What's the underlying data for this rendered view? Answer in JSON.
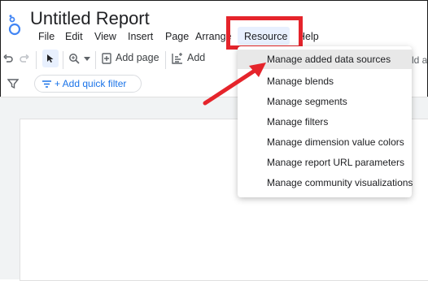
{
  "app": {
    "title": "Untitled Report"
  },
  "menubar": {
    "items": [
      "File",
      "Edit",
      "View",
      "Insert",
      "Page",
      "Arrange",
      "Help"
    ],
    "active": "Resource"
  },
  "toolbar": {
    "add_page_label": "Add page",
    "add_label_cut": "Add",
    "right_cut": "ld a"
  },
  "filterbar": {
    "quick_filter_label": "+ Add quick filter"
  },
  "dropdown": {
    "items": [
      "Manage added data sources",
      "Manage blends",
      "Manage segments",
      "Manage filters",
      "Manage dimension value colors",
      "Manage report URL parameters",
      "Manage community visualizations"
    ]
  },
  "colors": {
    "highlight_box": "#e5242b",
    "link": "#1a73e8",
    "active_menu_bg": "#e8f0fe"
  }
}
